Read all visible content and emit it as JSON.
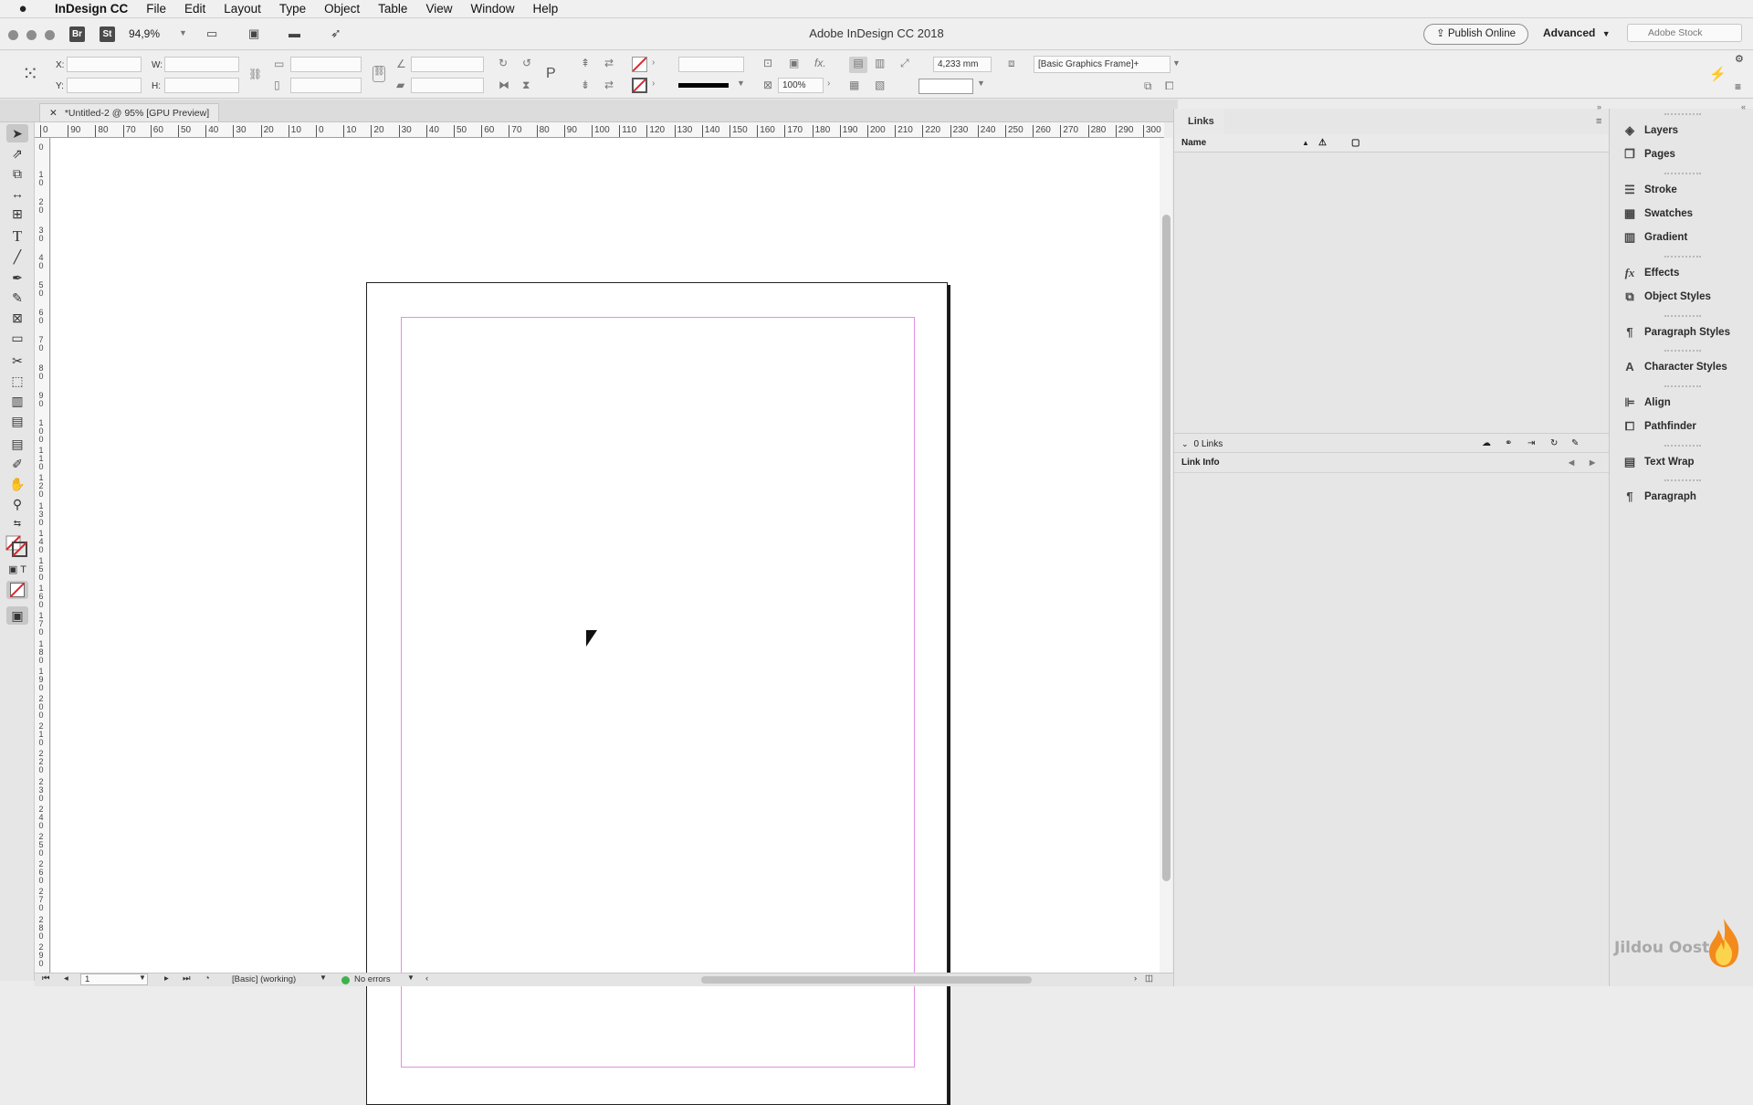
{
  "menubar": {
    "app_name": "InDesign CC",
    "items": [
      "File",
      "Edit",
      "Layout",
      "Type",
      "Object",
      "Table",
      "View",
      "Window",
      "Help"
    ]
  },
  "appbar": {
    "bridge_badge": "Br",
    "stock_badge": "St",
    "zoom": "94,9%",
    "window_title": "Adobe InDesign CC 2018",
    "publish_label": "Publish Online",
    "workspace_label": "Advanced",
    "stock_search_placeholder": "Adobe Stock"
  },
  "control": {
    "x_label": "X:",
    "y_label": "Y:",
    "w_label": "W:",
    "h_label": "H:",
    "stroke_weight": "4,233 mm",
    "opacity": "100%",
    "object_style": "[Basic Graphics Frame]+"
  },
  "document": {
    "tab_title": "*Untitled-2 @ 95% [GPU Preview]"
  },
  "rulers": {
    "horizontal": [
      "0",
      "90",
      "80",
      "70",
      "60",
      "50",
      "40",
      "30",
      "20",
      "10",
      "0",
      "10",
      "20",
      "30",
      "40",
      "50",
      "60",
      "70",
      "80",
      "90",
      "100",
      "110",
      "120",
      "130",
      "140",
      "150",
      "160",
      "170",
      "180",
      "190",
      "200",
      "210",
      "220",
      "230",
      "240",
      "250",
      "260",
      "270",
      "280",
      "290",
      "300"
    ],
    "vertical": [
      "0",
      "10",
      "20",
      "30",
      "40",
      "50",
      "60",
      "70",
      "80",
      "90",
      "100",
      "110",
      "120",
      "130",
      "140",
      "150",
      "160",
      "170",
      "180",
      "190",
      "200",
      "210",
      "220",
      "230",
      "240",
      "250",
      "260",
      "270",
      "280",
      "290"
    ]
  },
  "status": {
    "page_number": "1",
    "preflight_profile": "[Basic] (working)",
    "preflight_status": "No errors"
  },
  "links_panel": {
    "tab_label": "Links",
    "name_header": "Name",
    "links_count": "0 Links",
    "link_info_label": "Link Info"
  },
  "dock": {
    "items": [
      "Layers",
      "Pages",
      "Stroke",
      "Swatches",
      "Gradient",
      "Effects",
      "Object Styles",
      "Paragraph Styles",
      "Character Styles",
      "Align",
      "Pathfinder",
      "Text Wrap",
      "Paragraph"
    ]
  },
  "watermark": "Jildou Oost",
  "colors": {
    "margin_guide": "#e58ee5",
    "preflight_ok": "#3cb34a",
    "fill_none": "#d9262e"
  }
}
